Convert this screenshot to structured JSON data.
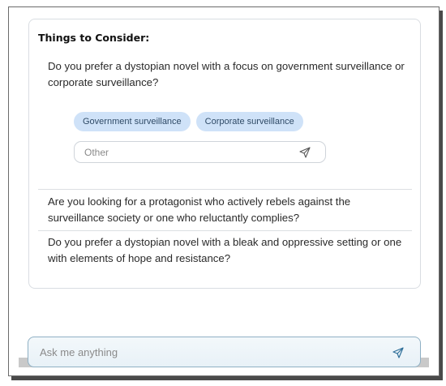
{
  "consider": {
    "title": "Things to Consider:",
    "q1": "Do you prefer a dystopian novel with a focus on government surveillance or corporate surveillance?",
    "chips": [
      "Government surveillance",
      "Corporate surveillance"
    ],
    "other_placeholder": "Other",
    "q2": "Are you looking for a protagonist who actively rebels against the surveillance society or one who reluctantly complies?",
    "q3": "Do you prefer a dystopian novel with a bleak and oppressive setting or one with elements of hope and resistance?"
  },
  "composer": {
    "placeholder": "Ask me anything",
    "send_icon": "send-icon"
  },
  "colors": {
    "chip_bg": "#cfe2f8",
    "composer_border": "#8fb0c4"
  }
}
